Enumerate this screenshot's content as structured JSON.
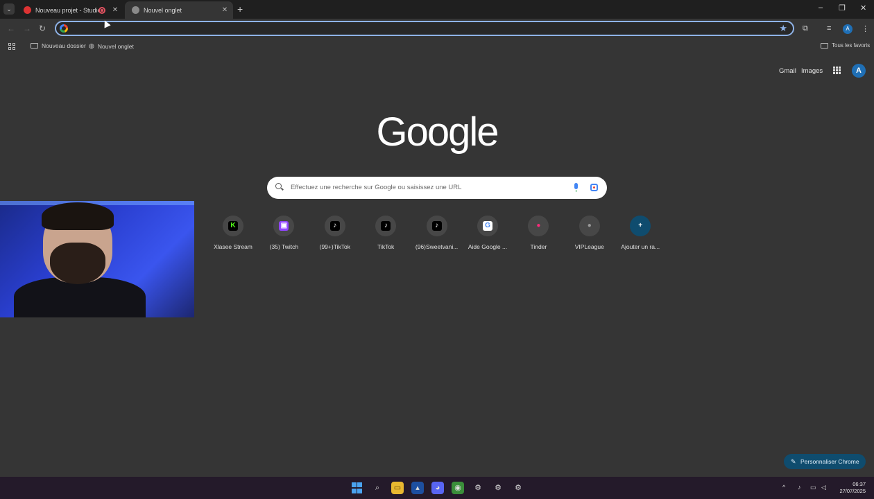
{
  "browser": {
    "tabs": [
      {
        "title": "Nouveau projet - Studio",
        "favicon": "studio-icon",
        "recording": true
      },
      {
        "title": "Nouvel onglet",
        "favicon": "chrome-icon",
        "active": true
      }
    ],
    "new_tab": "+",
    "window_controls": {
      "minimize": "–",
      "restore": "❐",
      "close": "✕"
    },
    "omnibox": {
      "value": ""
    },
    "bookmarks": [
      {
        "label": "Nouveau dossier",
        "icon": "folder-icon"
      },
      {
        "label": "Nouvel onglet",
        "icon": "globe-icon"
      }
    ],
    "all_bookmarks": "Tous les favoris",
    "profile_initial": "A"
  },
  "page": {
    "top_links": {
      "gmail": "Gmail",
      "images": "Images"
    },
    "account_initial": "A",
    "logo": "Google",
    "search_placeholder": "Effectuez une recherche sur Google ou saisissez une URL",
    "shortcuts": [
      {
        "label": "Xlasee Stream",
        "glyph": "K",
        "bg": "#000000",
        "fg": "#53fc18"
      },
      {
        "label": "(35) Twitch",
        "glyph": "▣",
        "bg": "#9146ff",
        "fg": "#ffffff"
      },
      {
        "label": "(99+)TikTok",
        "glyph": "♪",
        "bg": "#000000",
        "fg": "#ffffff"
      },
      {
        "label": "TikTok",
        "glyph": "♪",
        "bg": "#000000",
        "fg": "#ffffff"
      },
      {
        "label": "(96)Sweetvani...",
        "glyph": "♪",
        "bg": "#000000",
        "fg": "#ffffff"
      },
      {
        "label": "Aide Google ...",
        "glyph": "G",
        "bg": "#ffffff",
        "fg": "#4285f4"
      },
      {
        "label": "Tinder",
        "glyph": "●",
        "bg": "transparent",
        "fg": "#fd297b"
      },
      {
        "label": "VIPLeague",
        "glyph": "●",
        "bg": "transparent",
        "fg": "#9a9a9a"
      },
      {
        "label": "Ajouter un ra...",
        "glyph": "+",
        "bg": "transparent",
        "fg": "#ffffff"
      }
    ],
    "customize_label": "Personnaliser Chrome"
  },
  "taskbar": {
    "clock_time": "06:37",
    "clock_date": "27/07/2025"
  }
}
